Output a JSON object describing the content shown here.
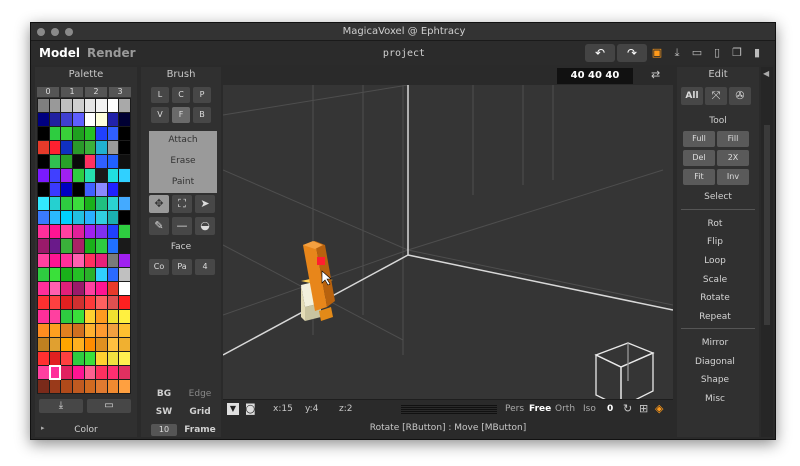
{
  "window": {
    "title": "MagicaVoxel @ Ephtracy"
  },
  "menu": {
    "model": "Model",
    "render": "Render",
    "project": "project"
  },
  "toolbar": {
    "undo": "↶",
    "redo": "↷",
    "icons": [
      "save-icon",
      "export-icon",
      "open-folder-icon",
      "new-file-icon",
      "copy-icon",
      "delete-icon"
    ]
  },
  "size": {
    "value": "40 40 40"
  },
  "palette": {
    "title": "Palette",
    "pages": [
      "0",
      "1",
      "2",
      "3"
    ],
    "color_label": "Color",
    "colors": [
      "#7f7f7f",
      "#999",
      "#bfbfbf",
      "#cfcfcf",
      "#e5e5e5",
      "#f2f2f2",
      "#fff",
      "#a9a9a9",
      "#000080",
      "#2020a0",
      "#4040d0",
      "#5f5fff",
      "#fff",
      "#ffd",
      "#2222aa",
      "#003",
      "#000",
      "#2ecc40",
      "#39d039",
      "#1fa01f",
      "#26c026",
      "#2040ff",
      "#3060ff",
      "#000",
      "#e53a2a",
      "#ff2030",
      "#1030c0",
      "#2a9a2a",
      "#3ab03a",
      "#20b0d0",
      "#9a9a9a",
      "#000",
      "#000",
      "#30c050",
      "#28a028",
      "#0a0a0a",
      "#ff3060",
      "#3060ff",
      "#2060ff",
      "#101010",
      "#7a1aff",
      "#4040ff",
      "#a020f0",
      "#2ecc40",
      "#25e0b0",
      "#1a1a1a",
      "#20e0e0",
      "#30d0ff",
      "#000",
      "#3a3aff",
      "#0000c0",
      "#000",
      "#4060ff",
      "#8a8aff",
      "#2020ff",
      "#111",
      "#32e8ff",
      "#25d0d0",
      "#2ecc40",
      "#3cdc3c",
      "#1ab01a",
      "#20c080",
      "#2bd2d2",
      "#4af",
      "#3a7aff",
      "#2abaff",
      "#00d0ff",
      "#22c0e0",
      "#2ab0ff",
      "#30d0e0",
      "#1ab0b0",
      "#000",
      "#ff2f9a",
      "#ff1493",
      "#ff40a0",
      "#e0209a",
      "#a020f0",
      "#8030f0",
      "#2040ff",
      "#2ecc40",
      "#9a1a6a",
      "#6a1a8a",
      "#3ab03a",
      "#aa2266",
      "#1ab01a",
      "#2ecc40",
      "#2070ff",
      "#1a1a1a",
      "#ff40a0",
      "#ff1493",
      "#ff2f9a",
      "#ff60b0",
      "#ff3060",
      "#e8207a",
      "#7a7a7a",
      "#a020f0",
      "#2ecc40",
      "#3ae03a",
      "#1ab01a",
      "#25c025",
      "#2ab02a",
      "#30d0ff",
      "#2a6aff",
      "#c0c0c0",
      "#ff2f9a",
      "#ff60b0",
      "#e0207a",
      "#9a1a6a",
      "#ff40a0",
      "#ff1493",
      "#e83a2a",
      "#ffffff",
      "#ff3030",
      "#ff4040",
      "#e02020",
      "#d03030",
      "#ff3a3a",
      "#ff6060",
      "#e05050",
      "#ff2020",
      "#ff2f9a",
      "#ff40a0",
      "#2ecc40",
      "#3ae03a",
      "#ffd030",
      "#ff9a20",
      "#f0e030",
      "#fff040",
      "#ff8c20",
      "#ffa020",
      "#e08020",
      "#d07020",
      "#ffb030",
      "#ff9a30",
      "#f0a040",
      "#ffc030",
      "#c08020",
      "#e0a030",
      "#ffa500",
      "#ffb020",
      "#ff8c00",
      "#e09020",
      "#ffc040",
      "#f0b030",
      "#ff3030",
      "#e02020",
      "#ff4040",
      "#2ecc40",
      "#3ae03a",
      "#ffd030",
      "#f0e040",
      "#fff050",
      "#ff40a0",
      "#ff2f9a",
      "#e02060",
      "#ff1493",
      "#ff6090",
      "#ff3060",
      "#ff2f70",
      "#e03060",
      "#7a2a1a",
      "#9a3a1a",
      "#b04a1a",
      "#c05a20",
      "#d06a20",
      "#e07a30",
      "#f08a30",
      "#ffa040"
    ]
  },
  "brush": {
    "title": "Brush",
    "types_row1": [
      "L",
      "C",
      "P"
    ],
    "types_row2": [
      "V",
      "F",
      "B"
    ],
    "modes": [
      "Attach",
      "Erase",
      "Paint"
    ],
    "face_label": "Face",
    "face_buttons": [
      "Co",
      "Pa",
      "4"
    ]
  },
  "bottom_left": {
    "bg": "BG",
    "edge": "Edge",
    "sw": "SW",
    "grid": "Grid",
    "frame_value": "10",
    "frame": "Frame"
  },
  "edit": {
    "title": "Edit",
    "all": "All",
    "tool_label": "Tool",
    "tools": [
      "Full",
      "Fill",
      "Del",
      "2X",
      "Fit",
      "Inv"
    ],
    "select": "Select",
    "actions": [
      "Rot",
      "Flip",
      "Loop",
      "Scale",
      "Rotate",
      "Repeat"
    ],
    "more": [
      "Mirror",
      "Diagonal",
      "Shape",
      "Misc"
    ]
  },
  "status": {
    "x": "x:15",
    "y": "y:4",
    "z": "z:2",
    "pers": "Pers",
    "free": "Free",
    "orth": "Orth",
    "iso": "Iso",
    "iso_value": "0"
  },
  "hint": "Rotate [RButton] : Move [MButton]"
}
